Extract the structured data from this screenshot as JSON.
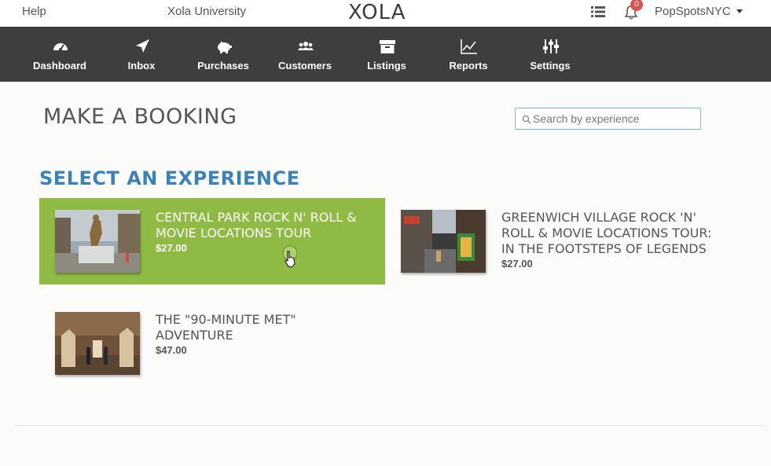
{
  "topbar": {
    "help": "Help",
    "org": "Xola University",
    "logo": "XOLA",
    "notification_count": "0",
    "account": "PopSpotsNYC"
  },
  "nav": [
    {
      "label": "Dashboard",
      "icon": "speedometer-icon"
    },
    {
      "label": "Inbox",
      "icon": "paper-plane-icon"
    },
    {
      "label": "Purchases",
      "icon": "piggy-bank-icon"
    },
    {
      "label": "Customers",
      "icon": "users-icon"
    },
    {
      "label": "Listings",
      "icon": "archive-box-icon"
    },
    {
      "label": "Reports",
      "icon": "line-chart-icon"
    },
    {
      "label": "Settings",
      "icon": "sliders-icon"
    }
  ],
  "page": {
    "title": "MAKE A BOOKING",
    "search_placeholder": "Search by experience",
    "section_title": "SELECT AN EXPERIENCE"
  },
  "experiences": [
    {
      "name": "CENTRAL PARK ROCK N' ROLL & MOVIE LOCATIONS TOUR",
      "price": "$27.00",
      "selected": true
    },
    {
      "name": "GREENWICH VILLAGE ROCK 'N' ROLL & MOVIE LOCATIONS TOUR: IN THE FOOTSTEPS OF LEGENDS",
      "price": "$27.00",
      "selected": false
    },
    {
      "name": "THE \"90-MINUTE MET\" ADVENTURE",
      "price": "$47.00",
      "selected": false
    }
  ],
  "colors": {
    "nav_bg": "#3e3e3e",
    "selected_card": "#8fbb45",
    "section_title": "#3b82b8",
    "badge": "#d9534f"
  }
}
